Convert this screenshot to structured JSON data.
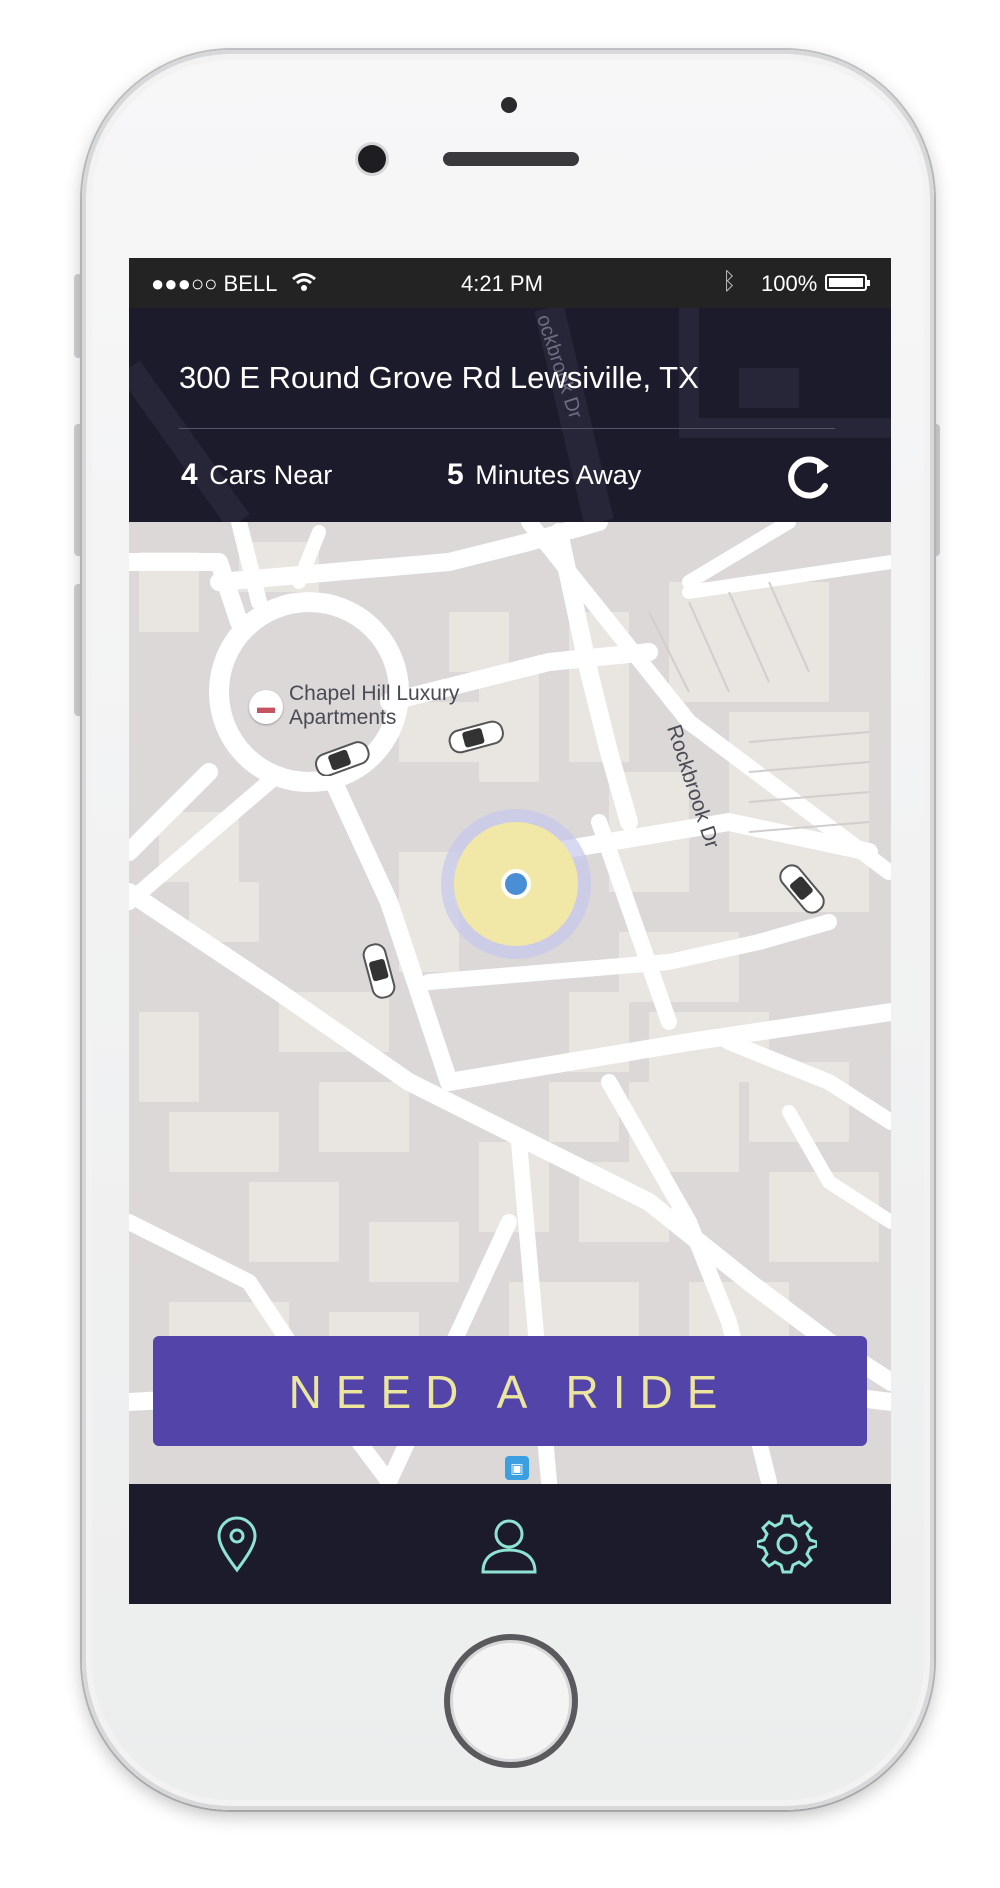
{
  "status_bar": {
    "carrier": "●●●○○ BELL",
    "time": "4:21 PM",
    "battery": "100%"
  },
  "header": {
    "address": "300 E Round Grove Rd Lewsiville, TX",
    "cars_count": "4",
    "cars_label": "Cars Near",
    "minutes_count": "5",
    "minutes_label": "Minutes Away"
  },
  "map": {
    "poi_line1": "Chapel Hill Luxury",
    "poi_line2": "Apartments",
    "street_label": "Rockbrook Dr",
    "header_street_label": "ockbrook Dr"
  },
  "actions": {
    "need_ride_label": "NEED A RIDE"
  },
  "tabs": [
    "location",
    "profile",
    "settings"
  ],
  "icons": {
    "refresh": "refresh-icon",
    "location": "location-pin-icon",
    "profile": "user-icon",
    "settings": "gear-icon",
    "bluetooth": "bluetooth-icon",
    "wifi": "wifi-icon",
    "car": "car-icon",
    "bus": "bus-stop-icon",
    "hotel": "hotel-icon"
  },
  "colors": {
    "accent_button": "#5244a8",
    "button_text": "#ece59e",
    "header_bg": "#1c1b2b",
    "tab_icon": "#8fe3d3",
    "user_dot": "#4a8fd6",
    "radius_fill": "#f1e7a6"
  }
}
